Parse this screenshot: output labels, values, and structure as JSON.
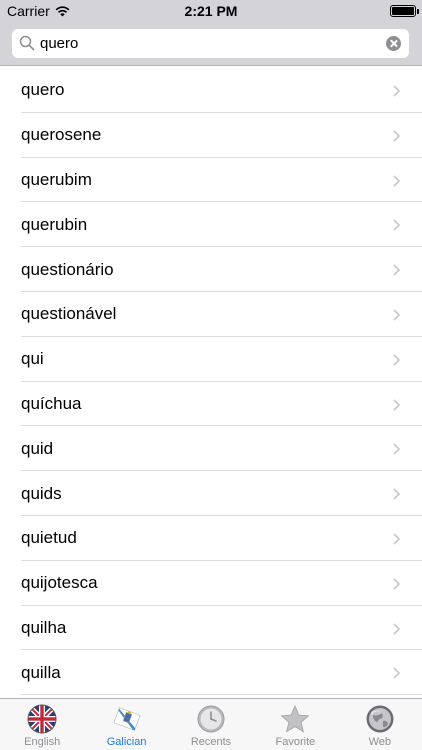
{
  "status_bar": {
    "carrier": "Carrier",
    "time": "2:21 PM",
    "battery_level": 1.0
  },
  "search": {
    "value": "quero",
    "icon": "search-icon",
    "clear_icon": "clear-icon"
  },
  "results": [
    {
      "label": "quero"
    },
    {
      "label": "querosene"
    },
    {
      "label": "querubim"
    },
    {
      "label": "querubin"
    },
    {
      "label": "questionário"
    },
    {
      "label": "questionável"
    },
    {
      "label": "qui"
    },
    {
      "label": "quíchua"
    },
    {
      "label": "quid"
    },
    {
      "label": "quids"
    },
    {
      "label": "quietud"
    },
    {
      "label": "quijotesca"
    },
    {
      "label": "quilha"
    },
    {
      "label": "quilla"
    }
  ],
  "tab_bar": {
    "tabs": [
      {
        "label": "English",
        "icon": "uk-flag-icon",
        "active": false
      },
      {
        "label": "Galician",
        "icon": "galicia-flag-icon",
        "active": true
      },
      {
        "label": "Recents",
        "icon": "clock-icon",
        "active": false
      },
      {
        "label": "Favorite",
        "icon": "star-icon",
        "active": false
      },
      {
        "label": "Web",
        "icon": "globe-icon",
        "active": false
      }
    ]
  },
  "colors": {
    "accent": "#1a7be0",
    "bar_bg": "#d3d3d8",
    "separator": "#dcdcdf"
  }
}
